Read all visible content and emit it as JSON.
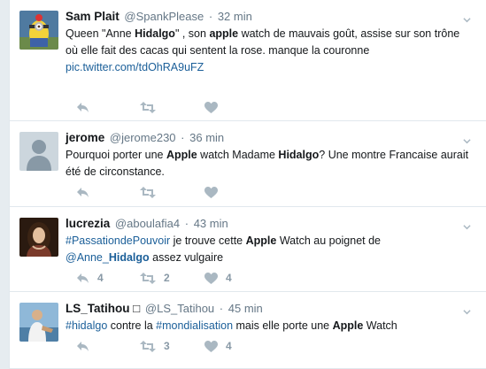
{
  "tweets": [
    {
      "name": "Sam Plait",
      "handle": "@SpankPlease",
      "time": "32 min",
      "t1": "Queen  \"Anne ",
      "t2": "Hidalgo",
      "t3": "\" , son ",
      "t4": "apple",
      "t5": " watch de mauvais goût, assise sur son trône où elle fait des cacas qui sentent la rose. manque la couronne",
      "link": "pic.twitter.com/tdOhRA9uFZ",
      "avatar": "minion-avatar",
      "reply_count": "",
      "retweet_count": "",
      "like_count": ""
    },
    {
      "name": "jerome",
      "handle": "@jerome230",
      "time": "36 min",
      "t1": "Pourquoi porter une ",
      "t2": "Apple",
      "t3": " watch Madame ",
      "t4": "Hidalgo",
      "t5": "? Une montre Francaise aurait été de circonstance.",
      "avatar": "default-avatar",
      "reply_count": "",
      "retweet_count": "",
      "like_count": ""
    },
    {
      "name": "lucrezia",
      "handle": "@aboulafia4",
      "time": "43 min",
      "hashtag": "#PassationdePouvoir",
      "t1": " je trouve cette ",
      "t2": "Apple",
      "t3": " Watch au poignet de ",
      "mention": "@Anne_",
      "mention_bold": "Hidalgo",
      "t4": " assez vulgaire",
      "avatar": "portrait-avatar",
      "reply_count": "4",
      "retweet_count": "2",
      "like_count": "4"
    },
    {
      "name": "LS_Tatihou",
      "name_glyph": "□",
      "handle": "@LS_Tatihou",
      "time": "45 min",
      "hashtag": "#hidalgo",
      "t1": " contre la ",
      "hashtag2": "#mondialisation",
      "t2": " mais elle porte une ",
      "t3": "Apple",
      "t4": " Watch",
      "avatar": "person-avatar",
      "reply_count": "",
      "retweet_count": "3",
      "like_count": "4"
    }
  ],
  "colors": {
    "link": "#1b5f99",
    "muted": "#657786",
    "icon": "#aab8c2",
    "border": "#e1e8ed"
  }
}
